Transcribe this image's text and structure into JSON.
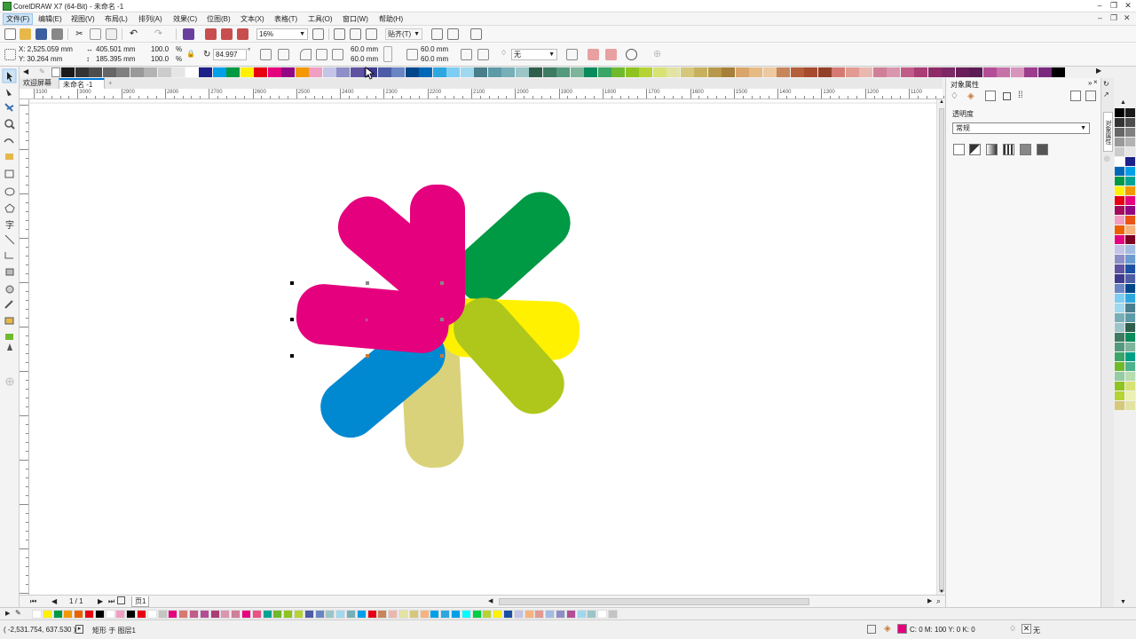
{
  "window": {
    "title": "CorelDRAW X7 (64-Bit) - 未命名 -1",
    "controls": [
      "–",
      "❐",
      "✕"
    ]
  },
  "menu": {
    "items": [
      "文件(F)",
      "编辑(E)",
      "视图(V)",
      "布局(L)",
      "排列(A)",
      "效果(C)",
      "位图(B)",
      "文本(X)",
      "表格(T)",
      "工具(O)",
      "窗口(W)",
      "帮助(H)"
    ],
    "right_controls": [
      "–",
      "❐",
      "✕"
    ]
  },
  "toolbar": {
    "zoom": "16%",
    "snap": "贴齐(T)"
  },
  "propbar": {
    "x": "X: 2,525.059 mm",
    "y": "Y: 30.264 mm",
    "width": "405.501 mm",
    "height": "185.395 mm",
    "scale_w": "100.0",
    "scale_h": "100.0",
    "pct1": "%",
    "pct2": "%",
    "rotation": "84.997",
    "degree": "°",
    "corner1": "60.0 mm",
    "corner2": "60.0 mm",
    "corner3": "60.0 mm",
    "corner4": "60.0 mm",
    "outline": "无"
  },
  "tabs": {
    "welcome": "欢迎屏幕",
    "doc": "未命名 -1",
    "add": "+"
  },
  "ruler": {
    "labels": [
      "3100",
      "3000",
      "2900",
      "2800",
      "2700",
      "2600",
      "2500",
      "2400",
      "2300",
      "2200",
      "2100",
      "2000",
      "1900",
      "1800",
      "1700",
      "1600",
      "1500",
      "1400",
      "1300",
      "1200",
      "1100",
      "1000"
    ]
  },
  "pagenav": {
    "counter": "1 / 1",
    "page_tab": "页1"
  },
  "status": {
    "coords": "( -2,531.754, 637.530 )",
    "object": "矩形 于 图层1",
    "fill": "C: 0 M: 100 Y: 0 K: 0",
    "outline": "无"
  },
  "docker": {
    "title": "对象属性",
    "section": "透明度",
    "mode": "常规"
  },
  "docker_tab": "对象属性",
  "colors": {
    "magenta": "#E5007E",
    "green": "#009944",
    "yellow": "#FFF100",
    "lime": "#AFC71B",
    "khaki": "#D9D27A",
    "blue": "#0088D1",
    "accent": "#0078D7"
  },
  "top_palette": [
    "#1a1a1a",
    "#333333",
    "#4d4d4d",
    "#666666",
    "#808080",
    "#999999",
    "#b3b3b3",
    "#cccccc",
    "#e6e6e6",
    "#ffffff",
    "#1d2088",
    "#00a0e9",
    "#009944",
    "#fff100",
    "#e60012",
    "#e5007e",
    "#920783",
    "#f39800",
    "#f19ec2",
    "#c4c4e6",
    "#8e8ec8",
    "#5f52a0",
    "#3e3a8e",
    "#4c5ca6",
    "#6a85c4",
    "#00478a",
    "#0068b7",
    "#2ea7e0",
    "#7ecef4",
    "#a0d8ef",
    "#4a7e8b",
    "#5d9aa8",
    "#77afb9",
    "#9cc5c8",
    "#2f5e4c",
    "#3f7a63",
    "#559a7e",
    "#7db59a",
    "#0b8a5c",
    "#39a567",
    "#6fba2c",
    "#8fc31f",
    "#b5d334",
    "#d7e374",
    "#e3e3a3",
    "#d6c87a",
    "#c7b15e",
    "#b8984b",
    "#a67f39",
    "#d9a56a",
    "#e6bb83",
    "#edc99f",
    "#c7855a",
    "#b5603a",
    "#a84a2d",
    "#934028",
    "#d57a72",
    "#e29a92",
    "#eab8b0",
    "#cf7f98",
    "#d996ae",
    "#c15c88",
    "#a93d75",
    "#8e2c68",
    "#7c2965",
    "#6a1f5a",
    "#5b1b55",
    "#b34e96",
    "#c672a9",
    "#d895bd",
    "#9c3d8e",
    "#7a2a7d",
    "#000000"
  ],
  "right_palette": [
    "#000000",
    "#1a1a1a",
    "#333333",
    "#4d4d4d",
    "#666666",
    "#808080",
    "#999999",
    "#b3b3b3",
    "#cccccc",
    "#e6e6e6",
    "#ffffff",
    "#1d2088",
    "#0068b7",
    "#00a0e9",
    "#009944",
    "#00a497",
    "#fff100",
    "#f39800",
    "#e60012",
    "#e5007e",
    "#a40b5d",
    "#920783",
    "#f19ec2",
    "#ea5514",
    "#eb6100",
    "#f6b37f",
    "#e4007f",
    "#7d0022",
    "#c4c4e6",
    "#a3bce2",
    "#8e8ec8",
    "#6c9bd2",
    "#5f52a0",
    "#1d50a2",
    "#3e3a8e",
    "#4c5ca6",
    "#6a85c4",
    "#00478a",
    "#7ecef4",
    "#2ea7e0",
    "#a0d8ef",
    "#4a7e8b",
    "#77afb9",
    "#5d9aa8",
    "#9cc5c8",
    "#2f5e4c",
    "#3f7a63",
    "#0b8a5c",
    "#559a7e",
    "#7db59a",
    "#39a567",
    "#00a086",
    "#6fba2c",
    "#4cb38c",
    "#93cda1",
    "#b8deb0",
    "#8fc31f",
    "#d7e374",
    "#b5d334",
    "#ebf1b3",
    "#d6c87a",
    "#e3e3a3"
  ],
  "bottom_palette": [
    "#ffffff",
    "#fff100",
    "#009944",
    "#f39800",
    "#eb6100",
    "#e60012",
    "#000000",
    "#ffffff",
    "#f19ec2",
    "#000000",
    "#e60012",
    "#ffffff",
    "#c4c4c4",
    "#e5007e",
    "#d57a72",
    "#c15c88",
    "#b34e96",
    "#a93d75",
    "#d996ae",
    "#cf7f98",
    "#e5007e",
    "#e95383",
    "#00a497",
    "#6fba2c",
    "#8fc31f",
    "#b5d334",
    "#4c5ca6",
    "#6a85c4",
    "#9cc5c8",
    "#a0d8ef",
    "#77afb9",
    "#00a0e9",
    "#e60012",
    "#c7855a",
    "#eab8b0",
    "#e3e3a3",
    "#d6c87a",
    "#f6b37f",
    "#00a0e9",
    "#2ea7e0",
    "#00a0e9",
    "#00ffff",
    "#00cc44",
    "#b5d334",
    "#fff100",
    "#1d50a2",
    "#c4c4e6",
    "#f6b37f",
    "#e29a92",
    "#a3bce2",
    "#8e8ec8",
    "#b34e96",
    "#a0d8ef",
    "#9cc5c8",
    "#ffffff",
    "#c4c4c4"
  ],
  "icons": {
    "toolbox": [
      "pick-tool-icon",
      "shape-tool-icon",
      "crop-tool-icon",
      "zoom-tool-icon",
      "freehand-tool-icon",
      "smart-fill-icon",
      "rectangle-tool-icon",
      "ellipse-tool-icon",
      "polygon-tool-icon",
      "text-tool-icon",
      "parallel-dimension-icon",
      "connector-tool-icon",
      "drop-shadow-icon",
      "transparency-tool-icon",
      "color-eyedropper-icon",
      "interactive-fill-icon",
      "smart-fill-2-icon",
      "outline-pen-icon",
      "add-tool-icon"
    ]
  }
}
